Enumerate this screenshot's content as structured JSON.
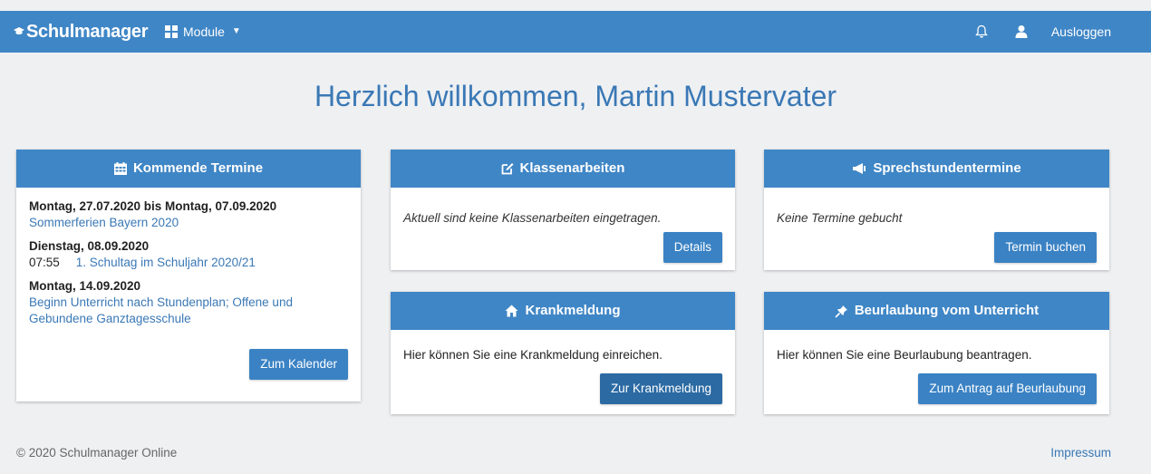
{
  "nav": {
    "brand": "Schulmanager",
    "modules_label": "Module",
    "logout_label": "Ausloggen"
  },
  "welcome": "Herzlich willkommen, Martin Mustervater",
  "termine": {
    "title": "Kommende Termine",
    "events": [
      {
        "date": "Montag, 27.07.2020 bis Montag, 07.09.2020",
        "time": "",
        "text": "Sommerferien Bayern 2020"
      },
      {
        "date": "Dienstag, 08.09.2020",
        "time": "07:55",
        "text": "1. Schultag im Schuljahr 2020/21"
      },
      {
        "date": "Montag, 14.09.2020",
        "time": "",
        "text": "Beginn Unterricht nach Stundenplan; Offene und Gebundene Ganztagesschule"
      }
    ],
    "button": "Zum Kalender"
  },
  "klassenarbeiten": {
    "title": "Klassenarbeiten",
    "text": "Aktuell sind keine Klassenarbeiten eingetragen.",
    "button": "Details"
  },
  "sprechstunden": {
    "title": "Sprechstundentermine",
    "text": "Keine Termine gebucht",
    "button": "Termin buchen"
  },
  "krankmeldung": {
    "title": "Krankmeldung",
    "text": "Hier können Sie eine Krankmeldung einreichen.",
    "button": "Zur Krankmeldung"
  },
  "beurlaubung": {
    "title": "Beurlaubung vom Unterricht",
    "text": "Hier können Sie eine Beurlaubung beantragen.",
    "button": "Zum Antrag auf Beurlaubung"
  },
  "footer": {
    "copyright": "© 2020 Schulmanager Online",
    "impressum": "Impressum"
  },
  "colors": {
    "primary": "#3f86c6",
    "link": "#3a78b5",
    "background": "#eef0f2"
  },
  "icons": [
    "graduation-cap-icon",
    "grid-icon",
    "bell-icon",
    "user-icon",
    "calendar-icon",
    "edit-icon",
    "megaphone-icon",
    "home-icon",
    "pin-icon"
  ]
}
